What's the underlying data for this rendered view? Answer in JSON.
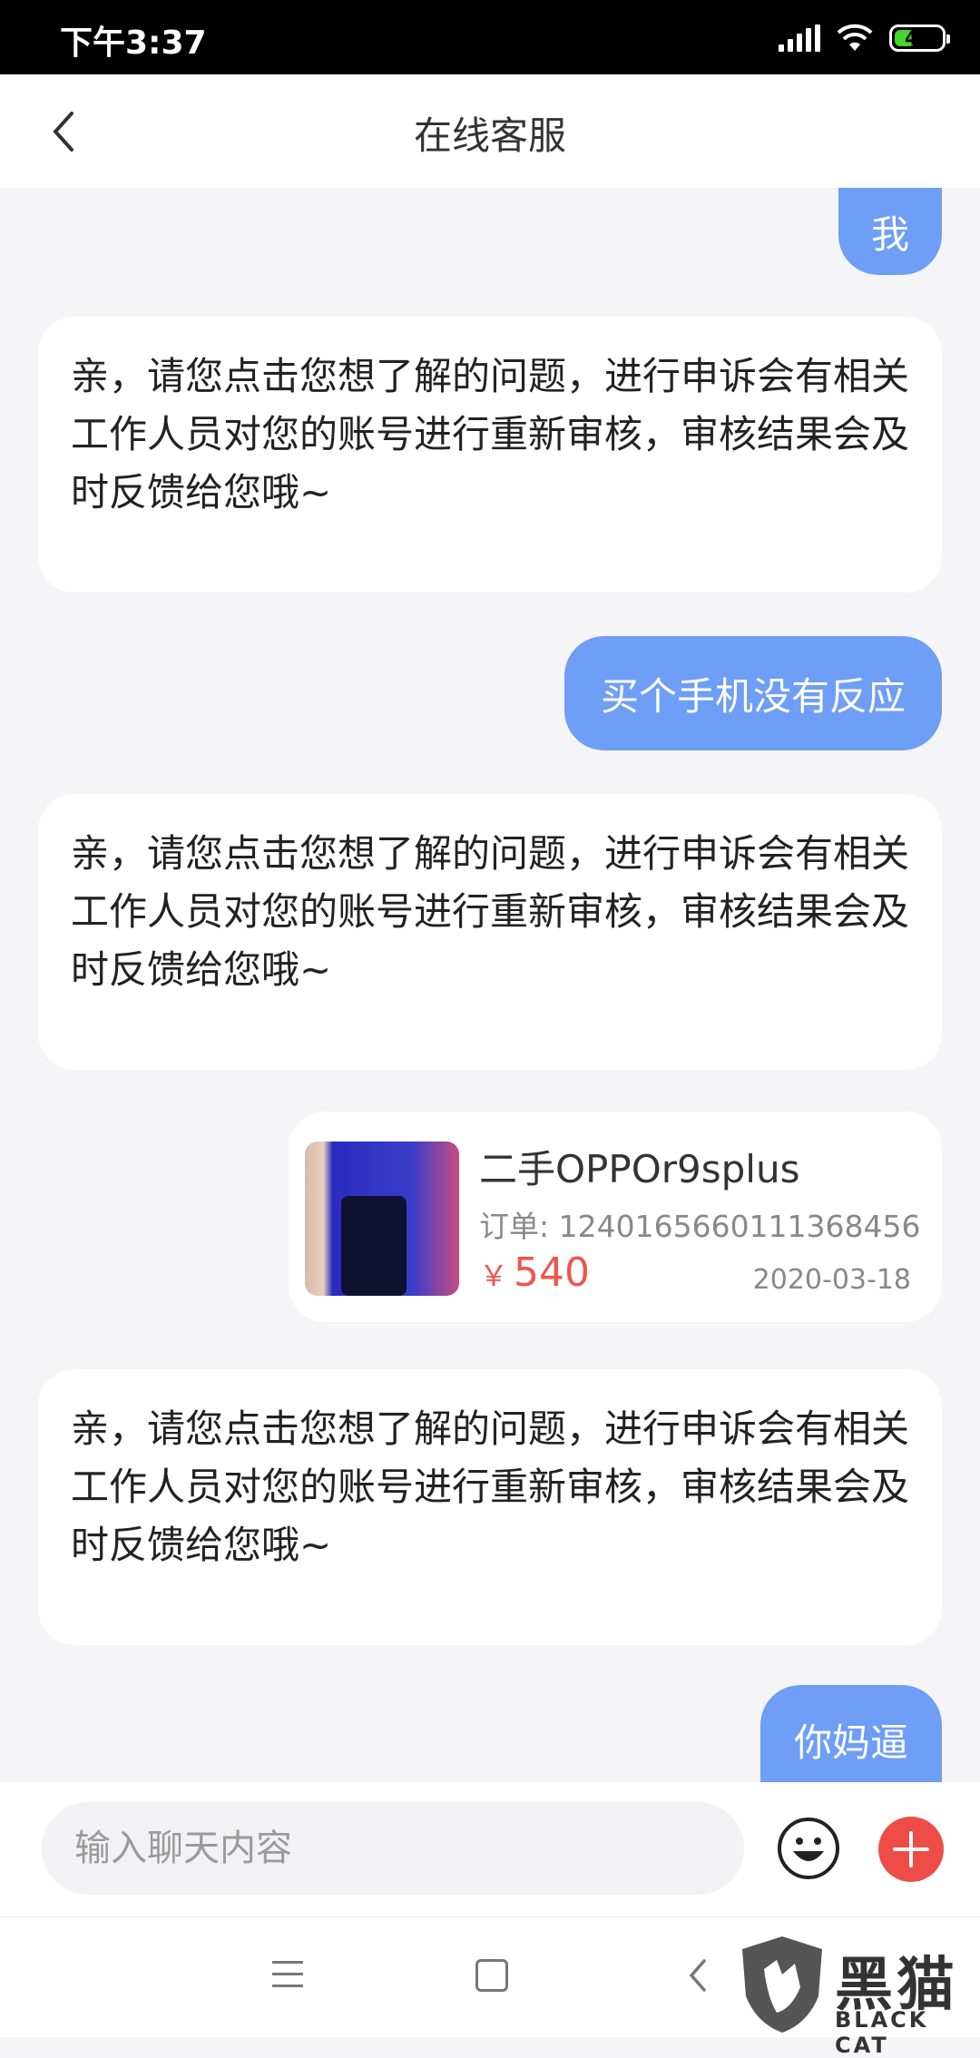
{
  "status_bar": {
    "time": "下午3:37",
    "battery": "42"
  },
  "header": {
    "title": "在线客服"
  },
  "messages": [
    {
      "from": "user",
      "text": "我"
    },
    {
      "from": "agent",
      "text": "亲，请您点击您想了解的问题，进行申诉会有相关工作人员对您的账号进行重新审核，审核结果会及时反馈给您哦~"
    },
    {
      "from": "user",
      "text": "买个手机没有反应"
    },
    {
      "from": "agent",
      "text": "亲，请您点击您想了解的问题，进行申诉会有相关工作人员对您的账号进行重新审核，审核结果会及时反馈给您哦~"
    },
    {
      "from": "agent",
      "text": "亲，请您点击您想了解的问题，进行申诉会有相关工作人员对您的账号进行重新审核，审核结果会及时反馈给您哦~"
    },
    {
      "from": "user",
      "text": "你妈逼"
    }
  ],
  "product_card": {
    "name": "二手OPPOr9splus",
    "order": "订单: 1240165660111368456",
    "currency": "￥",
    "price": "540",
    "date": "2020-03-18"
  },
  "input": {
    "placeholder": "输入聊天内容"
  },
  "icons": {
    "back": "back-chevron-icon",
    "emoji": "smiley-icon",
    "plus": "plus-icon",
    "nav_menu": "menu-icon",
    "nav_home": "home-square-icon",
    "nav_back": "back-triangle-icon"
  },
  "watermark": {
    "text": "黑猫",
    "sub": "BLACK CAT"
  },
  "colors": {
    "accent_bubble": "#6e9ef5",
    "price": "#f0554a",
    "plus_button": "#ee4c47"
  }
}
